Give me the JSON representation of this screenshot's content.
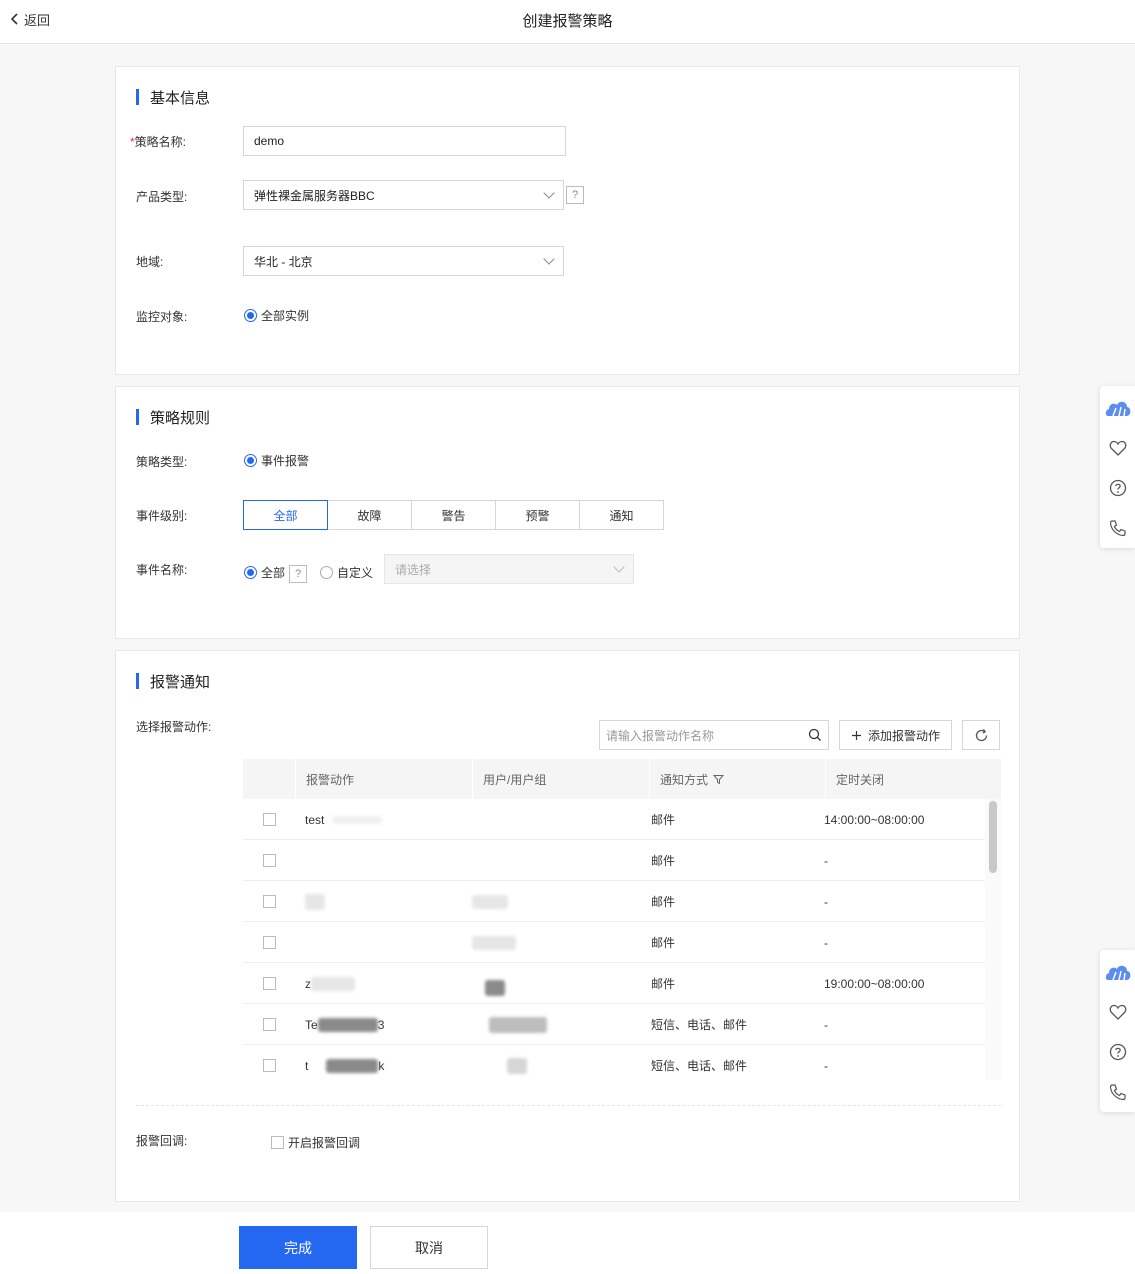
{
  "header": {
    "back_label": "返回",
    "title": "创建报警策略"
  },
  "basic": {
    "title": "基本信息",
    "name_label": "策略名称:",
    "name_required_mark": "*",
    "name_value": "demo",
    "product_label": "产品类型:",
    "product_value": "弹性裸金属服务器BBC",
    "region_label": "地域:",
    "region_value": "华北 - 北京",
    "target_label": "监控对象:",
    "target_option": "全部实例"
  },
  "rules": {
    "title": "策略规则",
    "type_label": "策略类型:",
    "type_option": "事件报警",
    "level_label": "事件级别:",
    "levels": [
      "全部",
      "故障",
      "警告",
      "预警",
      "通知"
    ],
    "event_label": "事件名称:",
    "event_all": "全部",
    "event_custom": "自定义",
    "event_placeholder": "请选择",
    "help_mark": "?"
  },
  "notify": {
    "title": "报警通知",
    "action_label": "选择报警动作:",
    "search_placeholder": "请输入报警动作名称",
    "add_button": "添加报警动作",
    "columns": [
      "报警动作",
      "用户/用户组",
      "通知方式",
      "定时关闭"
    ],
    "rows": [
      {
        "action": "test",
        "user": "",
        "method": "邮件",
        "time": "14:00:00~08:00:00"
      },
      {
        "action": "",
        "user": "",
        "method": "邮件",
        "time": "-"
      },
      {
        "action": "",
        "user": "",
        "method": "邮件",
        "time": "-"
      },
      {
        "action": "",
        "user": "",
        "method": "邮件",
        "time": "-"
      },
      {
        "action": "z",
        "user": "",
        "method": "邮件",
        "time": "19:00:00~08:00:00"
      },
      {
        "action": "Te",
        "action_suffix": "3",
        "user": "",
        "method": "短信、电话、邮件",
        "time": "-"
      },
      {
        "action": "t",
        "action_suffix": "k",
        "user": "",
        "method": "短信、电话、邮件",
        "time": "-"
      }
    ],
    "callback_label": "报警回调:",
    "callback_option": "开启报警回调"
  },
  "footer": {
    "submit": "完成",
    "cancel": "取消"
  },
  "colors": {
    "accent": "#2468f2",
    "required": "#ff3333"
  }
}
